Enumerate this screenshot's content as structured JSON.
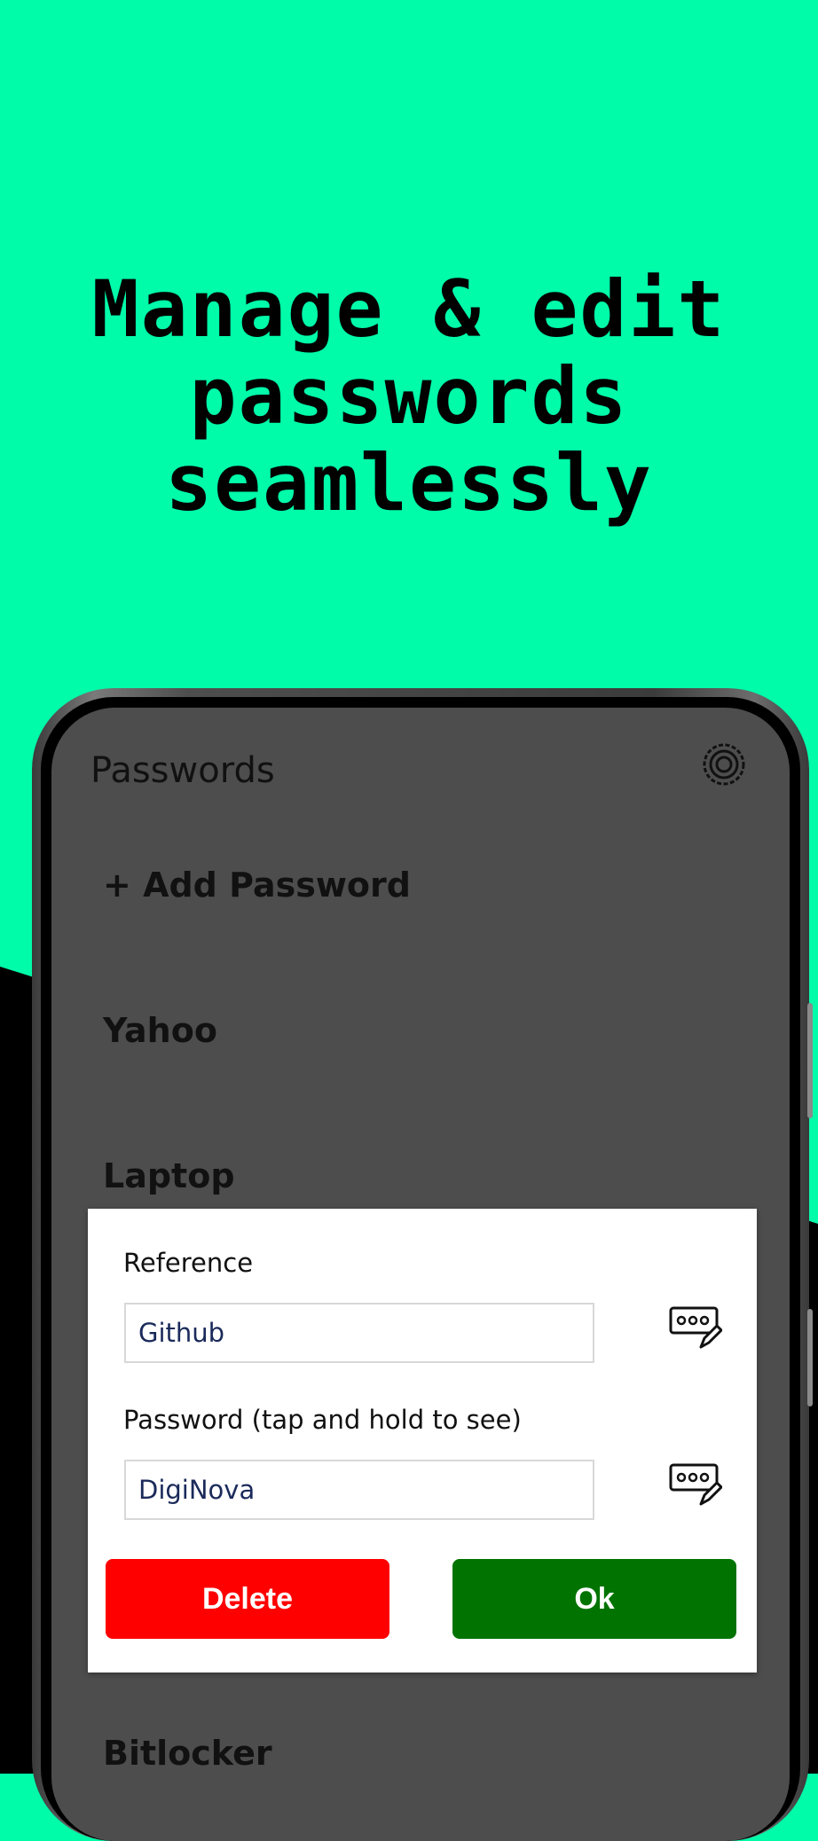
{
  "headline": "Manage & edit\npasswords\nseamlessly",
  "app": {
    "title": "Passwords",
    "settings_icon": "gear-icon"
  },
  "list": {
    "add_label": "+ Add Password",
    "items": [
      {
        "label": "Yahoo"
      },
      {
        "label": "Laptop"
      },
      {
        "label": "Bitlocker"
      }
    ]
  },
  "dialog": {
    "reference_label": "Reference",
    "reference_value": "Github",
    "password_label": "Password (tap and hold to see)",
    "password_value": "DigiNova",
    "edit_icon": "keyboard-edit-icon",
    "delete_label": "Delete",
    "ok_label": "Ok"
  },
  "colors": {
    "background": "#00FBA9",
    "delete": "#FF0000",
    "ok": "#007300",
    "screen": "#4D4D4D"
  }
}
